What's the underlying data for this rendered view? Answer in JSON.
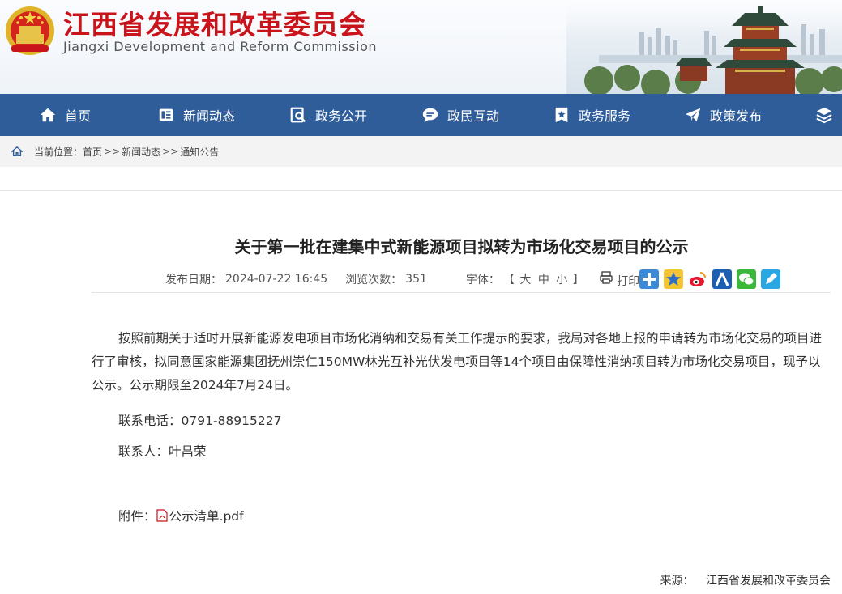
{
  "header": {
    "title": "江西省发展和改革委员会",
    "subtitle": "Jiangxi Development and Reform Commission",
    "emblem_icon": "national-emblem-icon"
  },
  "nav": {
    "items": [
      {
        "label": "首页",
        "icon": "home-icon"
      },
      {
        "label": "新闻动态",
        "icon": "news-icon"
      },
      {
        "label": "政务公开",
        "icon": "search-doc-icon"
      },
      {
        "label": "政民互动",
        "icon": "chat-icon"
      },
      {
        "label": "政务服务",
        "icon": "star-badge-icon"
      },
      {
        "label": "政策发布",
        "icon": "paper-plane-icon"
      },
      {
        "label": "",
        "icon": "layers-icon"
      }
    ],
    "bg_color": "#2f5d9a"
  },
  "breadcrumb": {
    "prefix": "当前位置：",
    "items": [
      "首页",
      "新闻动态",
      "通知公告"
    ],
    "separator": ">>"
  },
  "article": {
    "title": "关于第一批在建集中式新能源项目拟转为市场化交易项目的公示",
    "publish_label": "发布日期：",
    "publish_date": "2024-07-22 16:45",
    "views_label": "浏览次数：",
    "views": "351",
    "font_label": "字体：",
    "font_open": "【",
    "font_large": "大",
    "font_medium": "中",
    "font_small": "小",
    "font_close": "】",
    "print_label": "打印",
    "share_icons": [
      "share-plus-icon",
      "qzone-star-icon",
      "weibo-icon",
      "renren-icon",
      "wechat-icon",
      "pencil-share-icon"
    ],
    "body": "按照前期关于适时开展新能源发电项目市场化消纳和交易有关工作提示的要求，我局对各地上报的申请转为市场化交易的项目进行了审核，拟同意国家能源集团抚州崇仁150MW林光互补光伏发电项目等14个项目由保障性消纳项目转为市场化交易项目，现予以公示。公示期限至2024年7月24日。",
    "phone_line": "联系电话：0791-88915227",
    "contact_line": "联系人：叶昌荣",
    "attachment_label": "附件：",
    "attachment_name": "公示清单.pdf",
    "source_label": "来源：",
    "source_name": "江西省发展和改革委员会"
  }
}
